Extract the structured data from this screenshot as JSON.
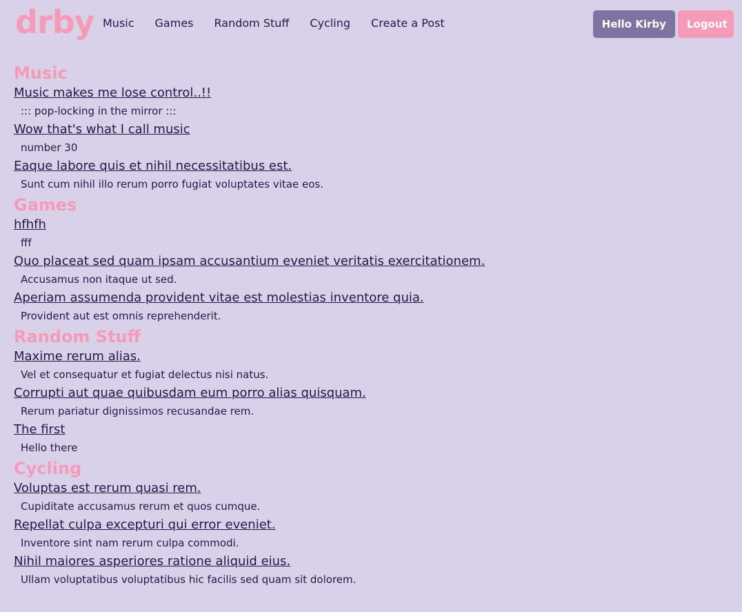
{
  "colors": {
    "background": "#d8d1e8",
    "accent": "#f59bb9",
    "text": "#1e1b4b",
    "user_button": "#7d73a0"
  },
  "navbar": {
    "logo": "drby",
    "links": [
      "Music",
      "Games",
      "Random Stuff",
      "Cycling",
      "Create a Post"
    ],
    "user_button": "Hello Kirby",
    "logout_button": "Logout"
  },
  "sections": [
    {
      "title": "Music",
      "posts": [
        {
          "title": "Music makes me lose control..!!",
          "body": "::: pop-locking in the mirror :::"
        },
        {
          "title": "Wow that's what I call music",
          "body": "number 30"
        },
        {
          "title": "Eaque labore quis et nihil necessitatibus est.",
          "body": "Sunt cum nihil illo rerum porro fugiat voluptates vitae eos."
        }
      ]
    },
    {
      "title": "Games",
      "posts": [
        {
          "title": "hfhfh",
          "body": "fff"
        },
        {
          "title": "Quo placeat sed quam ipsam accusantium eveniet veritatis exercitationem.",
          "body": "Accusamus non itaque ut sed."
        },
        {
          "title": "Aperiam assumenda provident vitae est molestias inventore quia.",
          "body": "Provident aut est omnis reprehenderit."
        }
      ]
    },
    {
      "title": "Random Stuff",
      "posts": [
        {
          "title": "Maxime rerum alias.",
          "body": "Vel et consequatur et fugiat delectus nisi natus."
        },
        {
          "title": "Corrupti aut quae quibusdam eum porro alias quisquam.",
          "body": "Rerum pariatur dignissimos recusandae rem."
        },
        {
          "title": "The first",
          "body": "Hello there"
        }
      ]
    },
    {
      "title": "Cycling",
      "posts": [
        {
          "title": "Voluptas est rerum quasi rem.",
          "body": "Cupiditate accusamus rerum et quos cumque."
        },
        {
          "title": "Repellat culpa excepturi qui error eveniet.",
          "body": "Inventore sint nam rerum culpa commodi."
        },
        {
          "title": "Nihil maiores asperiores ratione aliquid eius.",
          "body": "Ullam voluptatibus voluptatibus hic facilis sed quam sit dolorem."
        }
      ]
    }
  ]
}
